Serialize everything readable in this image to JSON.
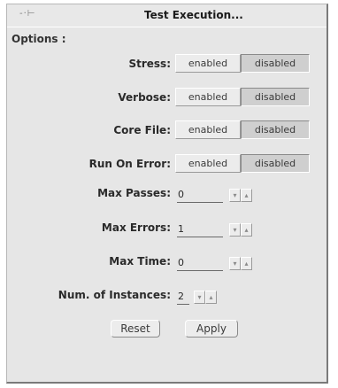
{
  "window": {
    "title": "Test Execution...",
    "menu_glyph": "-·⊢"
  },
  "options_label": "Options :",
  "toggles": [
    {
      "label": "Stress:",
      "on_label": "enabled",
      "off_label": "disabled",
      "selected": "disabled"
    },
    {
      "label": "Verbose:",
      "on_label": "enabled",
      "off_label": "disabled",
      "selected": "disabled"
    },
    {
      "label": "Core File:",
      "on_label": "enabled",
      "off_label": "disabled",
      "selected": "disabled"
    },
    {
      "label": "Run On Error:",
      "on_label": "enabled",
      "off_label": "disabled",
      "selected": "disabled"
    }
  ],
  "numeric_fields": [
    {
      "label": "Max Passes:",
      "value": "0"
    },
    {
      "label": "Max Errors:",
      "value": "1"
    },
    {
      "label": "Max Time:",
      "value": "0"
    }
  ],
  "instances": {
    "label": "Num. of Instances:",
    "value": "2"
  },
  "stepper_glyphs": {
    "down": "▾",
    "up": "▴"
  },
  "buttons": {
    "reset": "Reset",
    "apply": "Apply"
  }
}
